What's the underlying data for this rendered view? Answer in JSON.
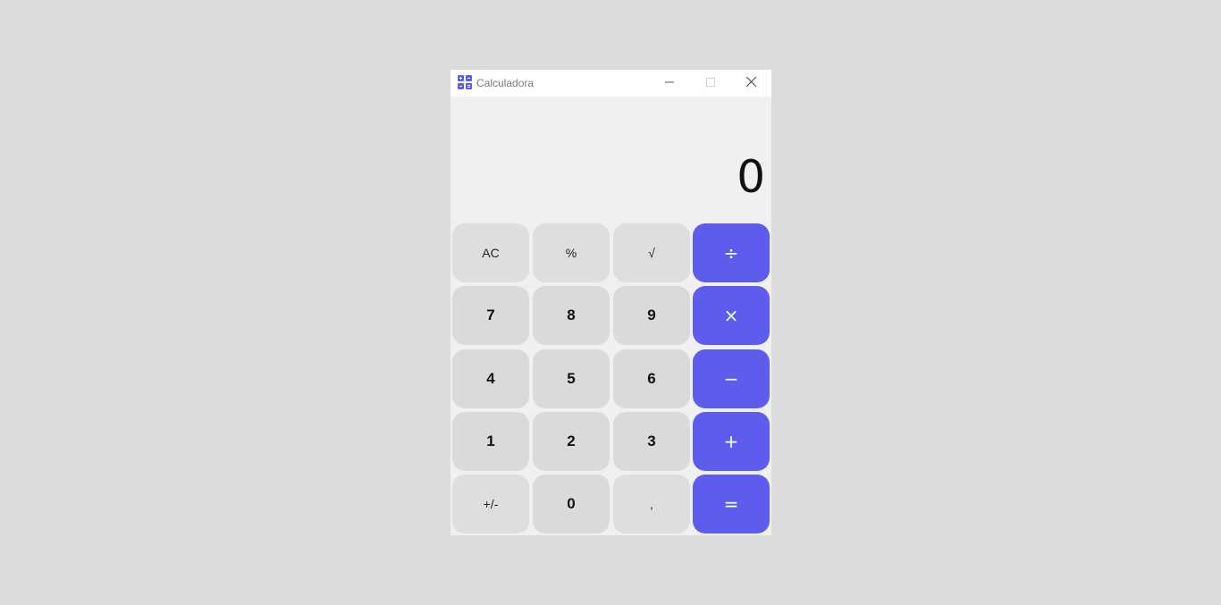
{
  "window": {
    "title": "Calculadora",
    "accent_color": "#5d5cec",
    "icons": {
      "app": "calculator-icon",
      "minimize": "minimize-icon",
      "maximize": "maximize-icon",
      "close": "close-icon"
    }
  },
  "display": {
    "value": "0"
  },
  "keypad": {
    "ac": "AC",
    "percent": "%",
    "sqrt": "√",
    "divide": "÷",
    "seven": "7",
    "eight": "8",
    "nine": "9",
    "multiply": "×",
    "four": "4",
    "five": "5",
    "six": "6",
    "minus": "−",
    "one": "1",
    "two": "2",
    "three": "3",
    "plus": "+",
    "negate": "+/-",
    "zero": "0",
    "decimal": ",",
    "equals": "="
  }
}
